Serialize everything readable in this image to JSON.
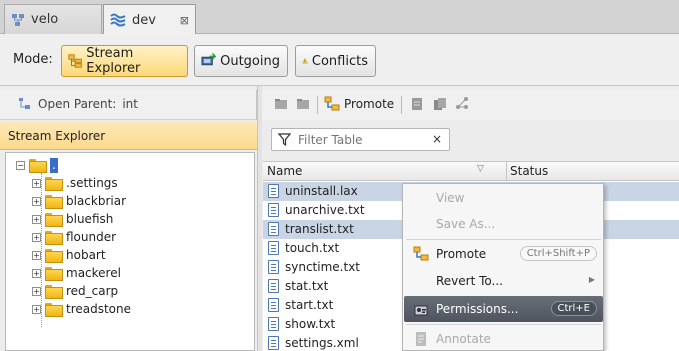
{
  "tabs": [
    {
      "label": "velo",
      "icon": "repository-icon"
    },
    {
      "label": "dev",
      "icon": "stream-icon",
      "close": "⊠"
    }
  ],
  "mode": {
    "label": "Mode:",
    "buttons": [
      {
        "label": "Stream Explorer",
        "icon": "stream-explorer-icon",
        "active": true
      },
      {
        "label": "Outgoing",
        "icon": "outgoing-icon",
        "active": false
      },
      {
        "label": "Conflicts",
        "icon": "warning-icon",
        "active": false
      }
    ]
  },
  "left_panel": {
    "open_parent_label": "Open Parent:",
    "open_parent_value": "int",
    "header": "Stream Explorer",
    "tree": {
      "root": ".",
      "children": [
        ".settings",
        "blackbriar",
        "bluefish",
        "flounder",
        "hobart",
        "mackerel",
        "red_carp",
        "treadstone"
      ]
    }
  },
  "right_panel": {
    "toolbar": {
      "promote_label": "Promote"
    },
    "filter": {
      "placeholder": "Filter Table",
      "clear": "×"
    },
    "columns": [
      "Name",
      "Status"
    ],
    "files": [
      {
        "name": "uninstall.lax",
        "selected": true
      },
      {
        "name": "unarchive.txt",
        "selected": false
      },
      {
        "name": "translist.txt",
        "selected": true
      },
      {
        "name": "touch.txt",
        "selected": false
      },
      {
        "name": "synctime.txt",
        "selected": false
      },
      {
        "name": "stat.txt",
        "selected": false
      },
      {
        "name": "start.txt",
        "selected": false
      },
      {
        "name": "show.txt",
        "selected": false
      },
      {
        "name": "settings.xml",
        "selected": false
      }
    ]
  },
  "context_menu": {
    "items": [
      {
        "label": "View",
        "enabled": false
      },
      {
        "label": "Save As...",
        "enabled": false
      },
      {
        "label": "Promote",
        "shortcut": "Ctrl+Shift+P",
        "enabled": true,
        "icon": "promote-icon"
      },
      {
        "label": "Revert To...",
        "enabled": true,
        "submenu": "▶"
      },
      {
        "label": "Permissions...",
        "shortcut": "Ctrl+E",
        "enabled": true,
        "highlighted": true,
        "icon": "permissions-icon"
      },
      {
        "label": "Annotate",
        "enabled": false,
        "icon": "annotate-icon"
      }
    ]
  },
  "colors": {
    "selection": "#c9d4e4",
    "header_accent": "#fbd98e",
    "menu_highlight": "#5a616a",
    "tree_root_selection": "#3a6cc8"
  }
}
